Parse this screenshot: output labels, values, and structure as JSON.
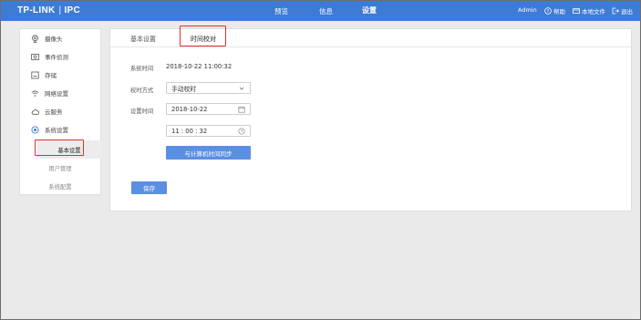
{
  "topbar": {
    "brand": "TP-LINK",
    "brand_sep": "|",
    "brand_product": "IPC",
    "nav": [
      "预览",
      "信息",
      "设置"
    ],
    "active_nav": "设置",
    "user": "Admin",
    "help": "帮助",
    "local_files": "本地文件",
    "logout": "退出"
  },
  "sidebar": {
    "items": [
      {
        "label": "摄像头",
        "icon": "camera-icon"
      },
      {
        "label": "事件侦测",
        "icon": "event-detection-icon"
      },
      {
        "label": "存储",
        "icon": "storage-icon"
      },
      {
        "label": "网络设置",
        "icon": "wifi-icon"
      },
      {
        "label": "云服务",
        "icon": "cloud-icon"
      },
      {
        "label": "系统设置",
        "icon": "system-settings-icon"
      }
    ],
    "subitems": [
      {
        "label": "基本设置",
        "active": true
      },
      {
        "label": "用户管理",
        "active": false
      },
      {
        "label": "系统配置",
        "active": false
      }
    ]
  },
  "tabs": {
    "basic": "基本设置",
    "time_sync": "时间校对",
    "active": "时间校对"
  },
  "form": {
    "system_time_label": "系统时间",
    "system_time_value": "2018-10-22 11:00:32",
    "sync_mode_label": "校时方式",
    "sync_mode_value": "手动校时",
    "set_time_label": "设置时间",
    "date_value": "2018-10-22",
    "time_value": "11 : 00 : 32",
    "sync_pc_button": "与计算机时间同步",
    "save_button": "保存"
  },
  "colors": {
    "topbar": "#3e7bd6",
    "button": "#5b8fe3",
    "highlight_box": "#e0302a"
  }
}
